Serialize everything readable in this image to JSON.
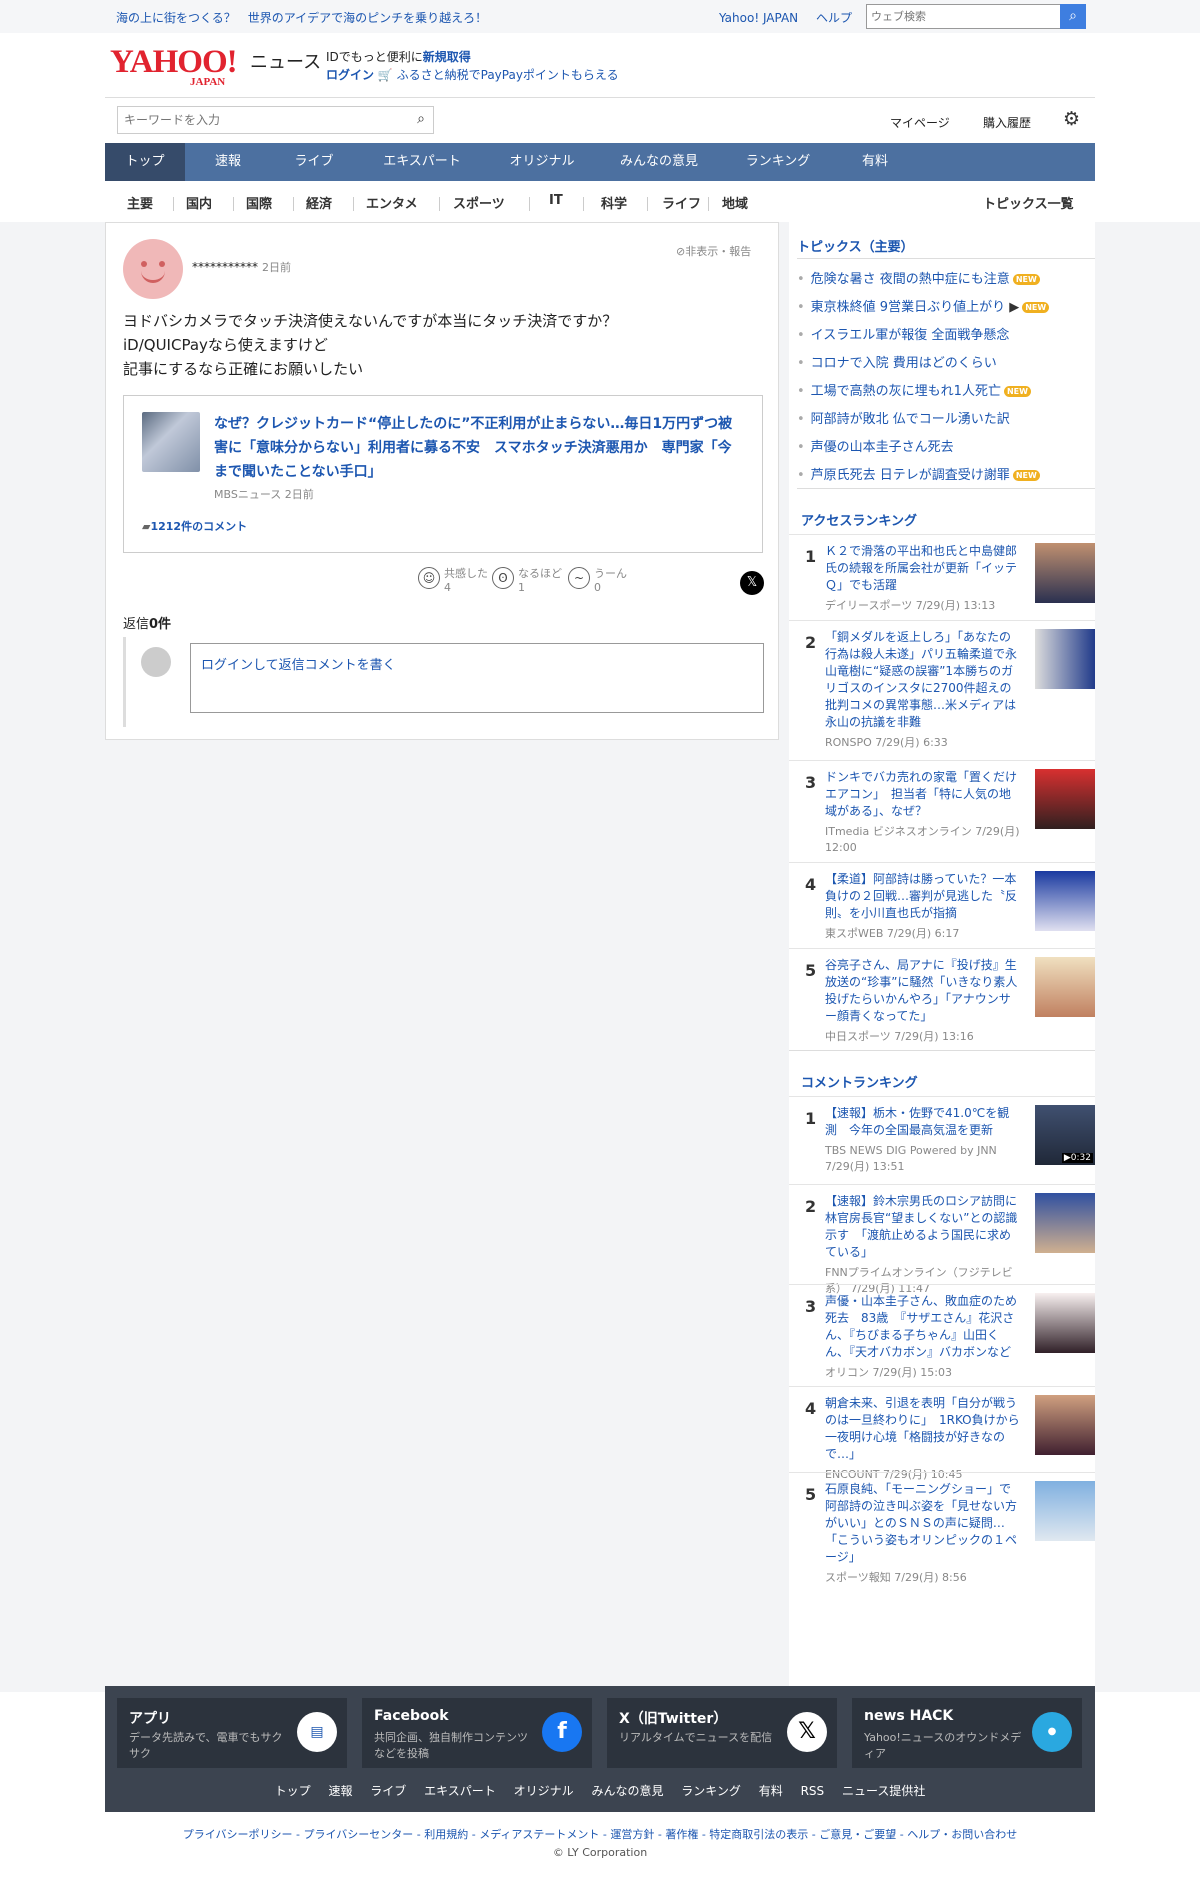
{
  "topbar": {
    "promo": "海の上に街をつくる？　世界のアイデアで海のピンチを乗り越えろ！",
    "links": [
      "Yahoo! JAPAN",
      "ヘルプ"
    ],
    "web_search_placeholder": "ウェブ検索"
  },
  "header": {
    "logo_main": "YAHOO!",
    "logo_sub": "JAPAN",
    "logo_news": "ニュース",
    "id_prefix": "IDでもっと便利に",
    "id_register": "新規取得",
    "login": "ログイン",
    "furusato": "ふるさと納税でPayPayポイントもらえる"
  },
  "search": {
    "placeholder": "キーワードを入力",
    "mypage": "マイページ",
    "history": "購入履歴"
  },
  "nav": [
    "トップ",
    "速報",
    "ライブ",
    "エキスパート",
    "オリジナル",
    "みんなの意見",
    "ランキング",
    "有料"
  ],
  "subnav": [
    "主要",
    "国内",
    "国際",
    "経済",
    "エンタメ",
    "スポーツ",
    "IT",
    "科学",
    "ライフ",
    "地域"
  ],
  "subnav_all": "トピックス一覧",
  "comment": {
    "user": "***********",
    "time": "2日前",
    "hide": "非表示・報告",
    "lines": [
      "ヨドバシカメラでタッチ決済使えないんですが本当にタッチ決済ですか？",
      "iD/QUICPayなら使えますけど",
      "記事にするなら正確にお願いしたい"
    ],
    "article_title": "なぜ？クレジットカード“停止したのに”不正利用が止まらない…毎日1万円ずつ被害に「意味分からない」利用者に募る不安　スマホタッチ決済悪用か　専門家「今まで聞いたことない手口」",
    "article_source": "MBSニュース 2日前",
    "article_comments": "1212件のコメント",
    "reactions": [
      {
        "label": "共感した",
        "count": "4"
      },
      {
        "label": "なるほど",
        "count": "1"
      },
      {
        "label": "うーん",
        "count": "0"
      }
    ],
    "replies_prefix": "返信",
    "replies_count": "0件",
    "reply_prompt": "ログインして返信コメントを書く"
  },
  "topics": {
    "heading": "トピックス（主要）",
    "items": [
      {
        "text": "危険な暑さ 夜間の熱中症にも注意",
        "badge": "NEW"
      },
      {
        "text": "東京株終値 9営業日ぶり値上がり",
        "badge": "NEW"
      },
      {
        "text": "イスラエル軍が報復 全面戦争懸念",
        "badge": ""
      },
      {
        "text": "コロナで入院 費用はどのくらい",
        "badge": ""
      },
      {
        "text": "工場で高熱の灰に埋もれ1人死亡",
        "badge": "NEW"
      },
      {
        "text": "阿部詩が敗北 仏でコール湧いた訳",
        "badge": ""
      },
      {
        "text": "声優の山本圭子さん死去",
        "badge": ""
      },
      {
        "text": "芦原氏死去 日テレが調査受け謝罪",
        "badge": "NEW"
      }
    ]
  },
  "access_ranking": {
    "heading": "アクセスランキング",
    "items": [
      {
        "rank": "1",
        "title": "Ｋ２で滑落の平出和也氏と中島健郎氏の続報を所属会社が更新「イッテＱ」でも活躍",
        "source": "デイリースポーツ 7/29(月) 13:13"
      },
      {
        "rank": "2",
        "title": "「銅メダルを返上しろ」「あなたの行為は殺人未遂」パリ五輪柔道で永山竜樹に“疑惑の誤審”1本勝ちのガリゴスのインスタに2700件超えの批判コメの異常事態…米メディアは永山の抗議を非難",
        "source": "RONSPO 7/29(月) 6:33"
      },
      {
        "rank": "3",
        "title": "ドンキでバカ売れの家電「置くだけエアコン」　担当者「特に人気の地域がある」、なぜ？",
        "source": "ITmedia ビジネスオンライン 7/29(月) 12:00"
      },
      {
        "rank": "4",
        "title": "【柔道】阿部詩は勝っていた？一本負けの２回戦…審判が見逃した〝反則〟を小川直也氏が指摘",
        "source": "東スポWEB 7/29(月) 6:17"
      },
      {
        "rank": "5",
        "title": "谷亮子さん、局アナに『投げ技』生放送の“珍事”に騒然「いきなり素人投げたらいかんやろ」「アナウンサー顔青くなってた」",
        "source": "中日スポーツ 7/29(月) 13:16"
      }
    ]
  },
  "comment_ranking": {
    "heading": "コメントランキング",
    "items": [
      {
        "rank": "1",
        "title": "【速報】栃木・佐野で41.0℃を観測　今年の全国最高気温を更新",
        "source": "TBS NEWS DIG Powered by JNN 7/29(月) 13:51",
        "video": "▶0:32"
      },
      {
        "rank": "2",
        "title": "【速報】鈴木宗男氏のロシア訪問に林官房長官“望ましくない”との認識示す　「渡航止めるよう国民に求めている」",
        "source": "FNNプライムオンライン（フジテレビ系） 7/29(月) 11:47",
        "video": ""
      },
      {
        "rank": "3",
        "title": "声優・山本圭子さん、敗血症のため死去　83歳　『サザエさん』花沢さん、『ちびまる子ちゃん』山田くん、『天才バカボン』バカボンなど",
        "source": "オリコン 7/29(月) 15:03",
        "video": ""
      },
      {
        "rank": "4",
        "title": "朝倉未来、引退を表明「自分が戦うのは一旦終わりに」　1RKO負けから一夜明け心境「格闘技が好きなので…」",
        "source": "ENCOUNT 7/29(月) 10:45",
        "video": ""
      },
      {
        "rank": "5",
        "title": "石原良純、「モーニングショー」で阿部詩の泣き叫ぶ姿を「見せない方がいい」とのＳＮＳの声に疑問…「こういう姿もオリンピックの１ページ」",
        "source": "スポーツ報知 7/29(月) 8:56",
        "video": ""
      }
    ]
  },
  "footer": {
    "boxes": [
      {
        "title": "アプリ",
        "desc": "データ先読みで、電車でもサクサク"
      },
      {
        "title": "Facebook",
        "desc": "共同企画、独自制作コンテンツなどを投稿"
      },
      {
        "title": "X（旧Twitter）",
        "desc": "リアルタイムでニュースを配信"
      },
      {
        "title": "news HACK",
        "desc": "Yahoo!ニュースのオウンドメディア"
      }
    ],
    "links": [
      "トップ",
      "速報",
      "ライブ",
      "エキスパート",
      "オリジナル",
      "みんなの意見",
      "ランキング",
      "有料",
      "RSS",
      "ニュース提供社"
    ],
    "legal": "プライバシーポリシー - プライバシーセンター - 利用規約 - メディアステートメント - 運営方針 - 著作権 - 特定商取引法の表示 - ご意見・ご要望 - ヘルプ・お問い合わせ",
    "copyright": "© LY Corporation"
  },
  "colors": {
    "link": "#1c56b0",
    "nav_bg": "#4c70a0",
    "nav_active": "#364b6a",
    "brand": "#e1232f"
  }
}
